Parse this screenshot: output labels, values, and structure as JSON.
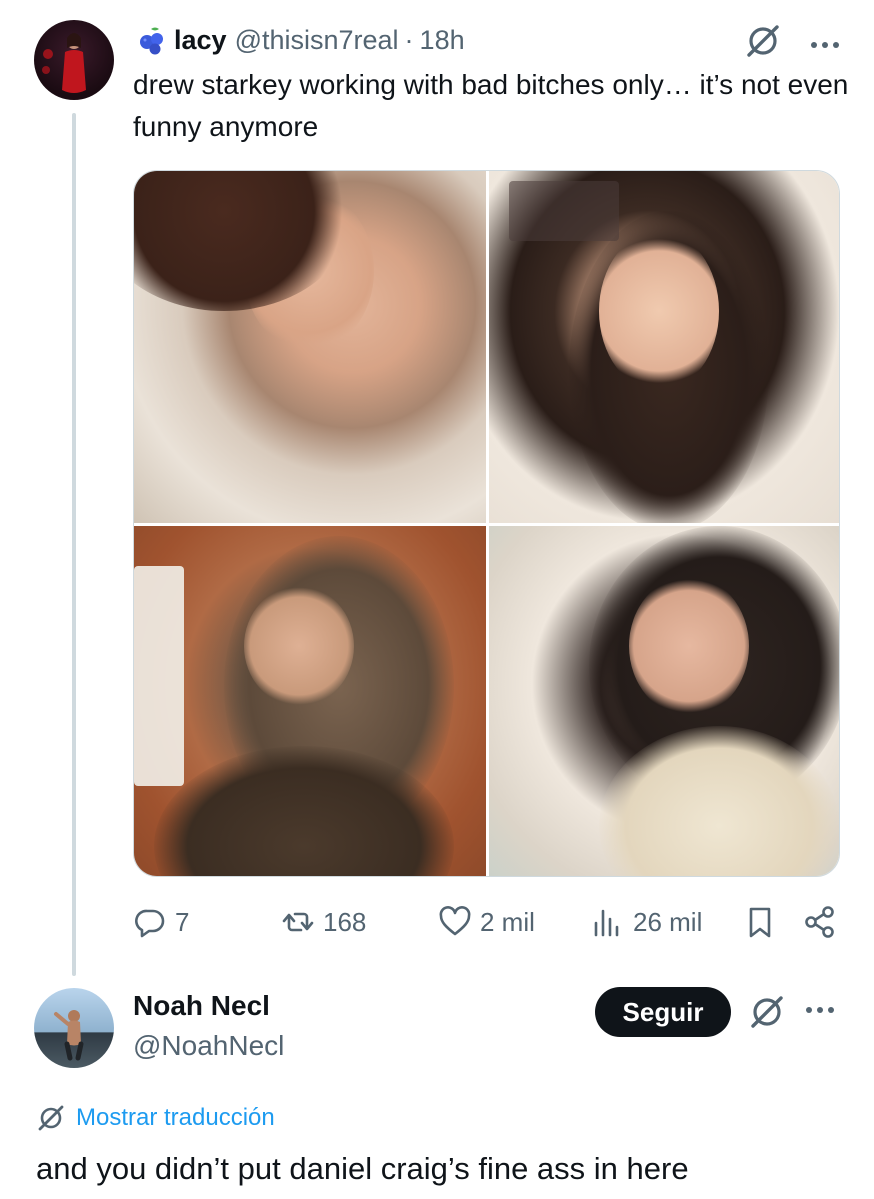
{
  "tweet": {
    "author_name": "lacy",
    "author_handle": "@thisisn7real",
    "separator": "·",
    "time": "18h",
    "text": "drew starkey working with bad bitches only… it’s not even funny anymore",
    "avatar_icon": "profile-photo",
    "name_emoji_icon": "blueberries-icon",
    "images": [
      {
        "icon": "photo-woman-in-bed"
      },
      {
        "icon": "photo-woman-with-long-dark-hair"
      },
      {
        "icon": "photo-woman-with-glasses"
      },
      {
        "icon": "photo-woman-in-lace-top"
      }
    ],
    "actions": {
      "replies": "7",
      "reposts": "168",
      "likes": "2 mil",
      "views": "26 mil"
    }
  },
  "reply": {
    "author_name": "Noah Necl",
    "author_handle": "@NoahNecl",
    "follow_label": "Seguir",
    "translate_label": "Mostrar traducción",
    "text": "and you didn’t put daniel craig’s fine ass in here"
  },
  "colors": {
    "text_primary": "#0f1419",
    "text_secondary": "#536471",
    "link_blue": "#1d9bf0",
    "thread_line": "#cfd9de",
    "button_dark": "#0f1419"
  }
}
